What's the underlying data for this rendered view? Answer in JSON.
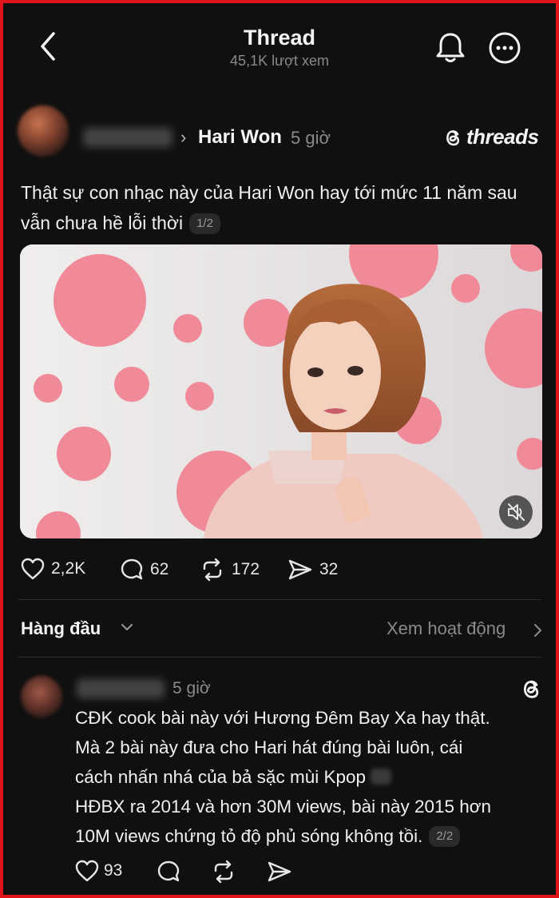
{
  "header": {
    "title": "Thread",
    "views": "45,1K lượt xem"
  },
  "post": {
    "author": "Hari Won",
    "time": "5 giờ",
    "brand": "threads",
    "text": "Thật sự con nhạc này của Hari Won hay tới mức 11 năm sau vẫn chưa hề lỗi thời",
    "pager": "1/2",
    "actions": {
      "likes": "2,2K",
      "comments": "62",
      "reposts": "172",
      "shares": "32"
    }
  },
  "sort": {
    "label": "Hàng đầu",
    "activity_link": "Xem hoạt động"
  },
  "reply": {
    "time": "5 giờ",
    "lines": [
      "CĐK cook bài này với Hương Đêm Bay Xa hay thật.",
      "Mà 2 bài này đưa cho Hari hát đúng bài luôn, cái",
      "cách nhấn nhá của bả sặc mùi Kpop",
      "HĐBX ra 2014 và hơn 30M views, bài này 2015 hơn",
      "10M views chứng tỏ độ phủ sóng không tồi."
    ],
    "pager": "2/2",
    "likes": "93"
  },
  "colors": {
    "frame_border": "#e0141b",
    "background": "#101010",
    "dot_pink": "#f08a98"
  }
}
